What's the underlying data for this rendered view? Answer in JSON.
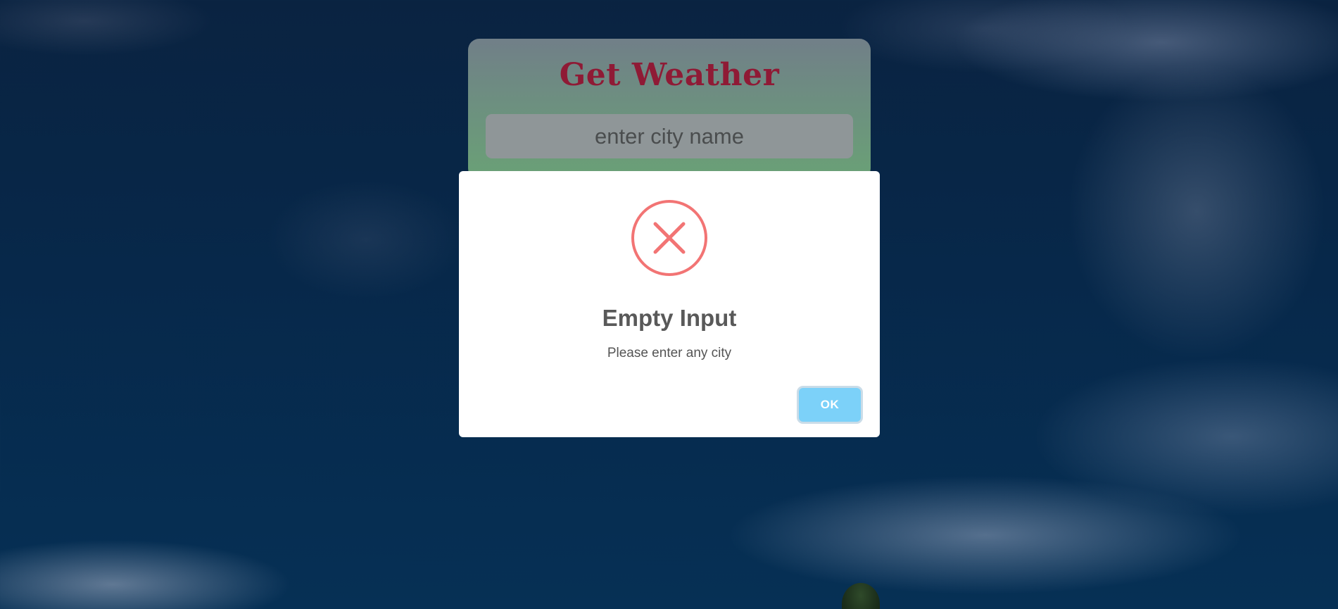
{
  "app": {
    "title": "Get Weather",
    "city_input": {
      "value": "",
      "placeholder": "enter city name"
    }
  },
  "dialog": {
    "icon": "error-x-icon",
    "title": "Empty Input",
    "message": "Please enter any city",
    "ok_label": "OK"
  },
  "colors": {
    "title_text": "#8f1a35",
    "error_icon": "#f27474",
    "ok_button": "#7cd1f9"
  }
}
